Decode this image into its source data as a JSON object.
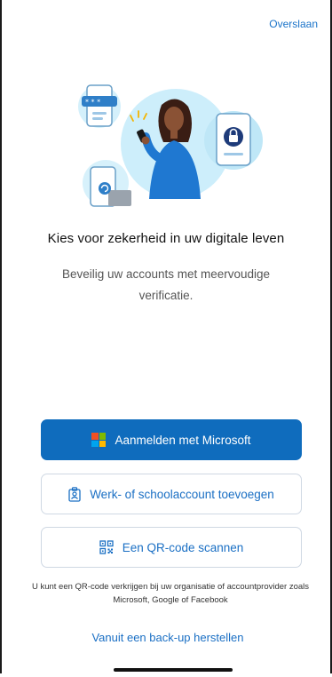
{
  "header": {
    "skip_label": "Overslaan"
  },
  "onboarding": {
    "title": "Kies voor zekerheid in uw digitale leven",
    "subtitle": "Beveilig uw accounts met meervoudige verificatie."
  },
  "actions": {
    "microsoft_label": "Aanmelden met Microsoft",
    "work_school_label": "Werk- of schoolaccount toevoegen",
    "qr_label": "Een QR-code scannen"
  },
  "info_text": "U kunt een QR-code verkrijgen bij uw organisatie of accountprovider zoals Microsoft, Google of Facebook",
  "restore_label": "Vanuit een back-up herstellen",
  "icons": {
    "microsoft": "microsoft-logo-icon",
    "work_school": "id-badge-icon",
    "qr": "qr-code-icon"
  },
  "colors": {
    "primary": "#0f6cbd",
    "link": "#1a6fc4",
    "ms_red": "#f25022",
    "ms_green": "#7fba00",
    "ms_blue": "#00a4ef",
    "ms_yellow": "#ffb900"
  }
}
